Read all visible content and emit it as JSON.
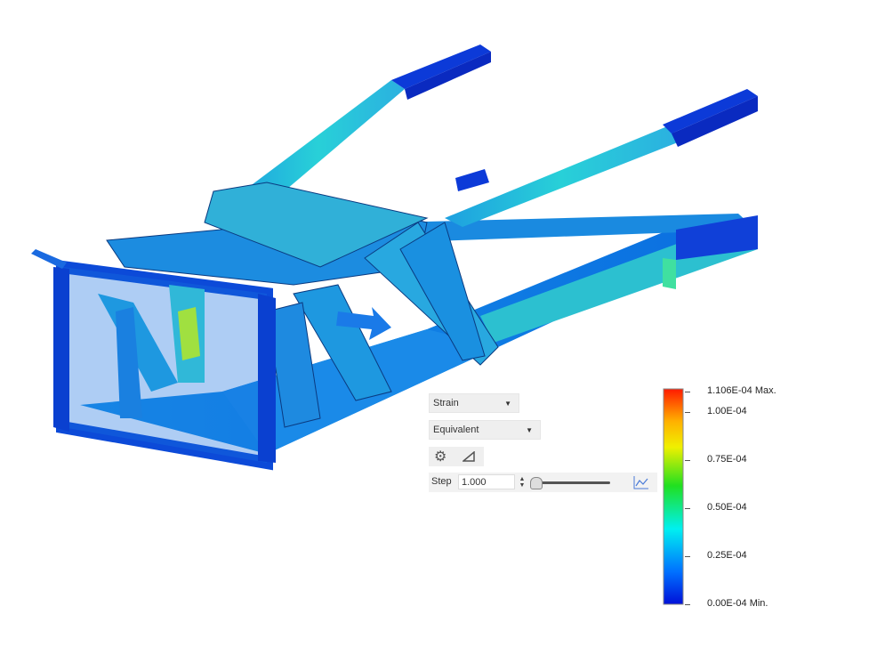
{
  "results_panel": {
    "result_type": "Strain",
    "component": "Equivalent",
    "step_label": "Step",
    "step_value": "1.000"
  },
  "legend": {
    "max_label": "1.106E-04 Max.",
    "labels": [
      "1.00E-04",
      "0.75E-04",
      "0.50E-04",
      "0.25E-04"
    ],
    "min_label": "0.00E-04 Min.",
    "colors": [
      "#ff0000",
      "#ffaa00",
      "#ffff00",
      "#00ff00",
      "#00ffff",
      "#0080ff",
      "#0000ff"
    ]
  },
  "icons": {
    "settings": "gear-icon",
    "probe": "triangle-probe-icon",
    "graph": "graph-icon"
  }
}
